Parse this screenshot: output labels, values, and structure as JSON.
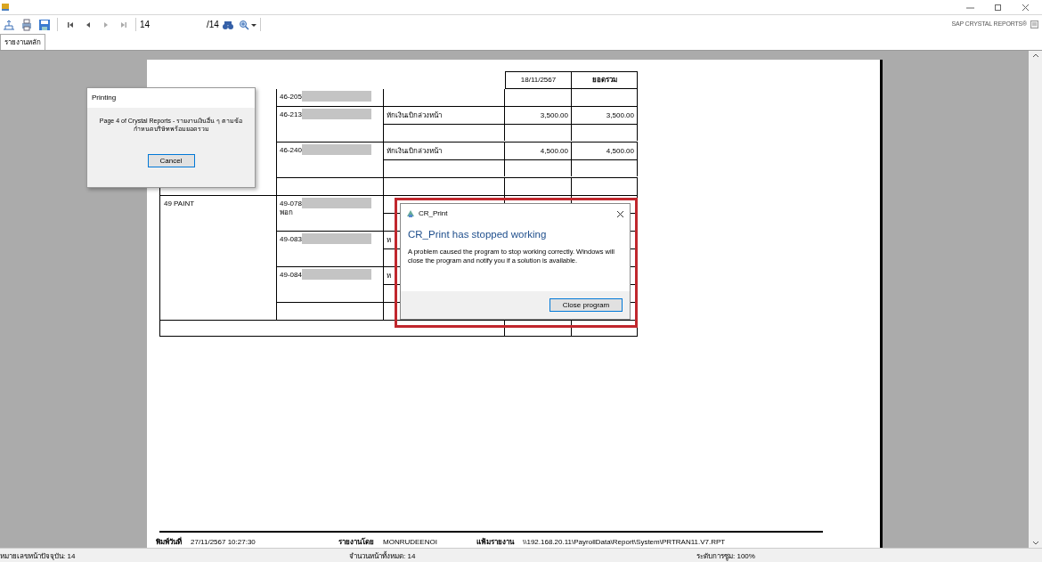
{
  "toolbar": {
    "page_field": "14",
    "page_total": "/14",
    "brand": "SAP CRYSTAL REPORTS®"
  },
  "tabs": [
    {
      "label": "รายงานหลัก",
      "selected": true
    }
  ],
  "report": {
    "header": {
      "date": "18/11/2567",
      "total_label": "ยอดรวม"
    },
    "groups": [
      {
        "entries": [
          {
            "kind": "single",
            "code": "46-205"
          },
          {
            "kind": "double",
            "code": "46-213",
            "desc": "หักเงินเบิกล่วงหน้า",
            "amount": "3,500.00",
            "total": "3,500.00"
          },
          {
            "kind": "double",
            "code": "46-240",
            "desc": "หักเงินเบิกล่วงหน้า",
            "amount": "4,500.00",
            "total": "4,500.00"
          },
          {
            "kind": "blank"
          }
        ]
      },
      {
        "name": "49 PAINT",
        "entries": [
          {
            "kind": "double",
            "code": "49-078",
            "note": "พอก"
          },
          {
            "kind": "double",
            "code": "49-083",
            "desc": "ห"
          },
          {
            "kind": "double",
            "code": "49-084",
            "desc": "ห"
          },
          {
            "kind": "blank"
          }
        ]
      }
    ],
    "footer": [
      {
        "label": "พิมพ์วันที่",
        "value": "27/11/2567  10:27:30"
      },
      {
        "label": "รายงานโดย",
        "value": "MONRUDEENOI"
      },
      {
        "label": "แฟ้มรายงาน",
        "value": "\\\\192.168.20.11\\PayrollData\\Report\\System\\PRTRAN11.V7.RPT"
      }
    ]
  },
  "printing_dialog": {
    "title": "Printing",
    "message": "Page 4 of Crystal Reports - รายงานเงินอื่น ๆ ตามข้อกำหนดบริษัทพร้อมยอดรวม",
    "button": "Cancel"
  },
  "error_dialog": {
    "title": "CR_Print",
    "heading": "CR_Print has stopped working",
    "message": "A problem caused the program to stop working correctly. Windows will close the program and notify you if a solution is available.",
    "button": "Close program"
  },
  "status_bar": [
    "หมายเลขหน้าปัจจุบัน: 14",
    "จำนวนหน้าทั้งหมด: 14",
    "ระดับการซูม: 100%"
  ]
}
